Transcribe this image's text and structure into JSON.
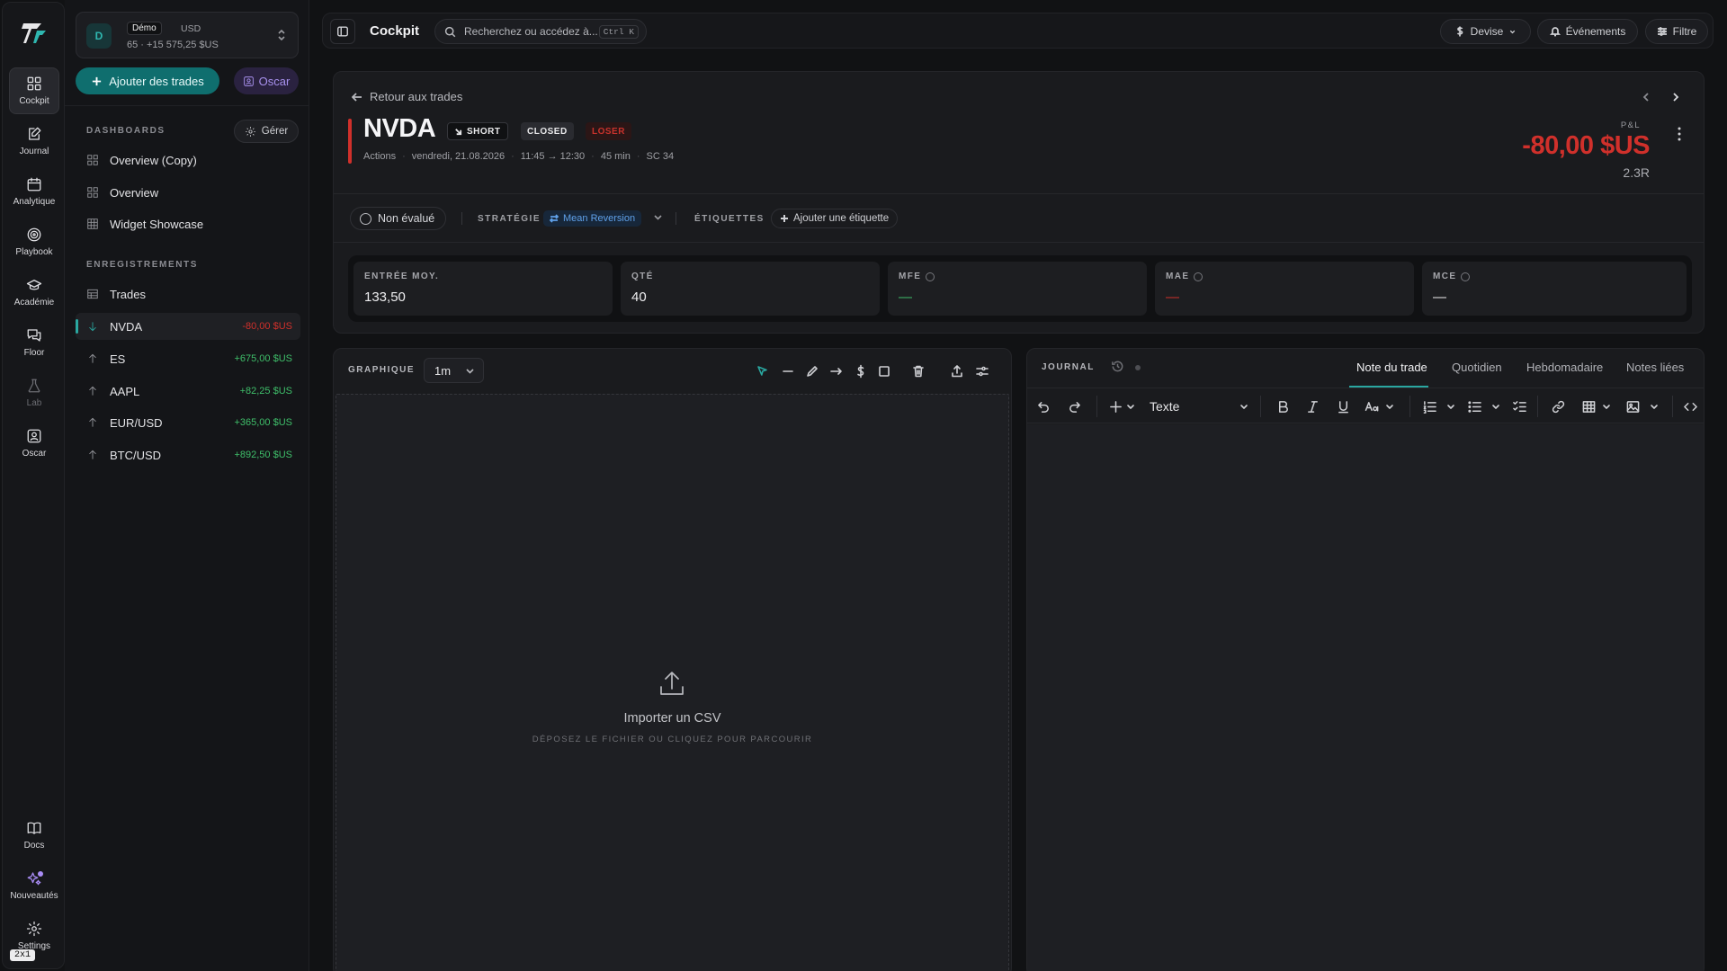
{
  "rail": {
    "items": [
      {
        "label": "Cockpit",
        "icon": "dashboard-icon"
      },
      {
        "label": "Journal",
        "icon": "journal-edit-icon"
      },
      {
        "label": "Analytique",
        "icon": "calendar-icon"
      },
      {
        "label": "Playbook",
        "icon": "target-icon"
      },
      {
        "label": "Académie",
        "icon": "graduation-cap-icon"
      },
      {
        "label": "Floor",
        "icon": "chat-bubbles-icon"
      },
      {
        "label": "Lab",
        "icon": "flask-icon"
      },
      {
        "label": "Oscar",
        "icon": "assistant-portrait-icon"
      },
      {
        "label": "Docs",
        "icon": "book-icon"
      },
      {
        "label": "Nouveautés",
        "icon": "sparkles-icon"
      },
      {
        "label": "Settings",
        "icon": "gear-icon"
      }
    ],
    "ratio_badge": "2x1"
  },
  "account": {
    "avatar": "D",
    "badge": "Démo",
    "currency": "USD",
    "summary": "65 · +15 575,25 $US"
  },
  "sidebar": {
    "add_trades": "Ajouter des trades",
    "oscar": "Oscar",
    "dashboards_title": "DASHBOARDS",
    "manage": "Gérer",
    "dashboards": [
      "Overview (Copy)",
      "Overview",
      "Widget Showcase"
    ],
    "records_title": "ENREGISTREMENTS",
    "trades": "Trades",
    "records": [
      {
        "symbol": "NVDA",
        "pl": "-80,00 $US",
        "dir": "down"
      },
      {
        "symbol": "ES",
        "pl": "+675,00 $US",
        "dir": "up"
      },
      {
        "symbol": "AAPL",
        "pl": "+82,25 $US",
        "dir": "up"
      },
      {
        "symbol": "EUR/USD",
        "pl": "+365,00 $US",
        "dir": "up"
      },
      {
        "symbol": "BTC/USD",
        "pl": "+892,50 $US",
        "dir": "up"
      }
    ]
  },
  "topbar": {
    "title": "Cockpit",
    "search_placeholder": "Recherchez ou accédez à...",
    "shortcut": "Ctrl K",
    "currency": "Devise",
    "events": "Événements",
    "filter": "Filtre"
  },
  "trade": {
    "back": "Retour aux trades",
    "symbol": "NVDA",
    "side": "SHORT",
    "status": "CLOSED",
    "result": "LOSER",
    "meta": [
      "Actions",
      "vendredi, 21.08.2026",
      "11:45 → 12:30",
      "45 min",
      "SC 34"
    ],
    "pl_label": "P&L",
    "pl_value": "-80,00 $US",
    "r_multiple": "2.3R",
    "evaluation": "Non évalué",
    "strategy_label": "STRATÉGIE",
    "strategy": "Mean Reversion",
    "tags_label": "ÉTIQUETTES",
    "add_tag": "Ajouter une étiquette",
    "stats": [
      {
        "label": "ENTRÉE MOY.",
        "value": "133,50",
        "info": false,
        "color": "#eeeef0"
      },
      {
        "label": "QTÉ",
        "value": "40",
        "info": false,
        "color": "#eeeef0"
      },
      {
        "label": "MFE",
        "value": "—",
        "info": true,
        "color": "#3fbf6a"
      },
      {
        "label": "MAE",
        "value": "—",
        "info": true,
        "color": "#d0302b"
      },
      {
        "label": "MCE",
        "value": "—",
        "info": true,
        "color": "#eeeef0"
      }
    ]
  },
  "chart_panel": {
    "title": "GRAPHIQUE",
    "timeframe": "1m",
    "import_title": "Importer un CSV",
    "import_hint": "DÉPOSEZ LE FICHIER OU CLIQUEZ POUR PARCOURIR"
  },
  "journal": {
    "title": "JOURNAL",
    "tabs": [
      "Note du trade",
      "Quotidien",
      "Hebdomadaire",
      "Notes liées"
    ],
    "block_type": "Texte"
  },
  "colors": {
    "accent": "#0f6e6e",
    "loss": "#d0302b",
    "gain": "#3fbf6a",
    "violet": "#a891ee"
  }
}
